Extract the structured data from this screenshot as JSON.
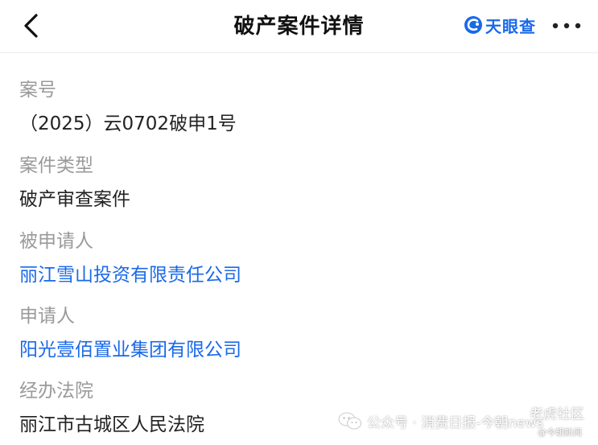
{
  "header": {
    "title": "破产案件详情",
    "brand": "天眼查",
    "accent_color": "#1a69e8",
    "back_icon": "chevron-left-icon",
    "more_icon": "more-dots-icon"
  },
  "fields": [
    {
      "label": "案号",
      "value": "（2025）云0702破申1号",
      "is_link": false
    },
    {
      "label": "案件类型",
      "value": "破产审查案件",
      "is_link": false
    },
    {
      "label": "被申请人",
      "value": "丽江雪山投资有限责任公司",
      "is_link": true
    },
    {
      "label": "申请人",
      "value": "阳光壹佰置业集团有限公司",
      "is_link": true
    },
    {
      "label": "经办法院",
      "value": "丽江市古城区人民法院",
      "is_link": false
    }
  ],
  "watermark": {
    "text": "公众号 · 消费日报-今朝news",
    "icon": "wechat-icon",
    "corner_text": "老虎社区",
    "credit": "@今朝新闻"
  }
}
